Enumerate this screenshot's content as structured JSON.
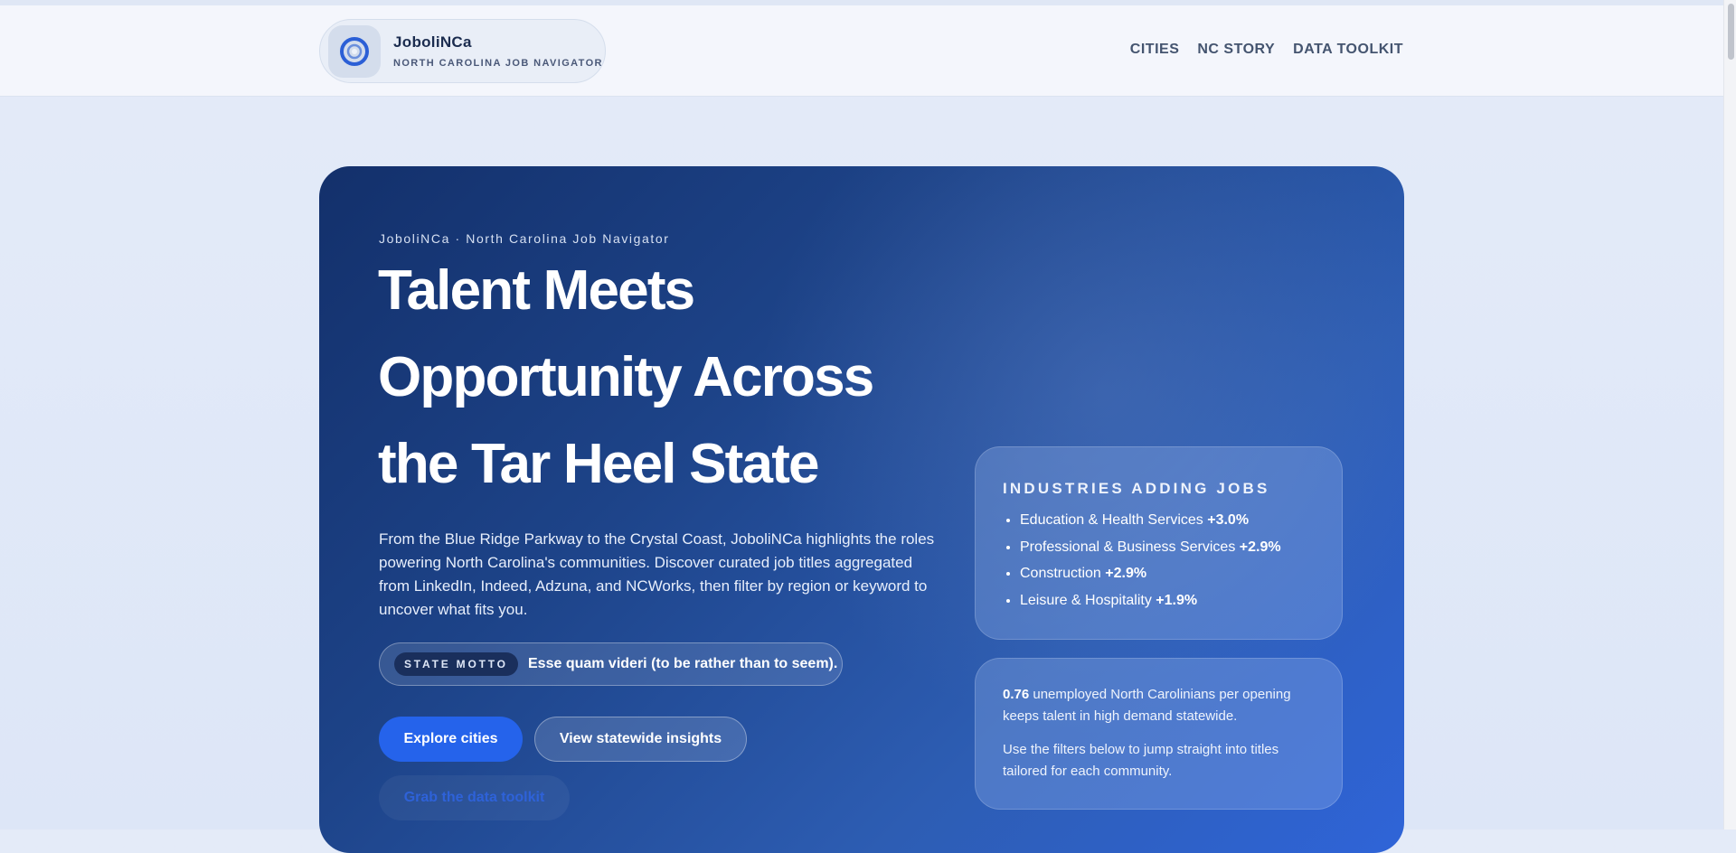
{
  "brand": {
    "name": "JoboliNCa",
    "tagline": "NORTH CAROLINA JOB NAVIGATOR",
    "logo_icon": "target-ring-icon"
  },
  "nav": {
    "links": [
      "CITIES",
      "NC STORY",
      "DATA TOOLKIT"
    ]
  },
  "hero": {
    "eyebrow": "JoboliNCa · North Carolina Job Navigator",
    "title": "Talent Meets Opportunity Across the Tar Heel State",
    "description": "From the Blue Ridge Parkway to the Crystal Coast, JoboliNCa highlights the roles powering North Carolina's communities. Discover curated job titles aggregated from LinkedIn, Indeed, Adzuna, and NCWorks, then filter by region or keyword to uncover what fits you.",
    "motto": {
      "label": "STATE MOTTO",
      "text": "Esse quam videri (to be rather than to seem)."
    },
    "buttons": {
      "primary": "Explore cities",
      "secondary": "View statewide insights",
      "toolkit": "Grab the data toolkit"
    }
  },
  "industries": {
    "title": "INDUSTRIES ADDING JOBS",
    "items": [
      {
        "name": "Education & Health Services",
        "change": "+3.0%"
      },
      {
        "name": "Professional & Business Services",
        "change": "+2.9%"
      },
      {
        "name": "Construction",
        "change": "+2.9%"
      },
      {
        "name": "Leisure & Hospitality",
        "change": "+1.9%"
      }
    ]
  },
  "stats": {
    "ratio": "0.76",
    "ratio_text": "unemployed North Carolinians per opening keeps talent in high demand statewide.",
    "filter_tip": "Use the filters below to jump straight into titles tailored for each community."
  },
  "colors": {
    "accent": "#2563eb",
    "hero_start": "#13306b",
    "hero_end": "#2f64d8",
    "page_bg": "#e4ebf8"
  }
}
